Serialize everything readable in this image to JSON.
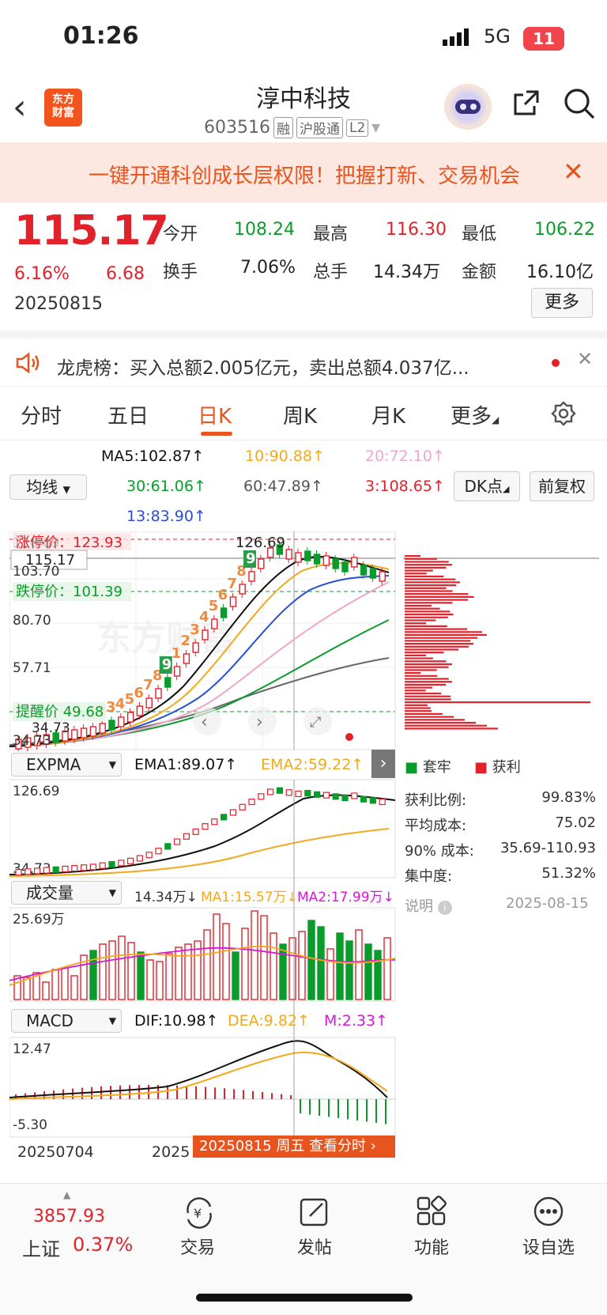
{
  "status": {
    "time": "01:26",
    "network": "5G",
    "battery": "11"
  },
  "header": {
    "app_logo": [
      "东方",
      "财富"
    ],
    "stock_name": "淳中科技",
    "stock_code": "603516",
    "tags": [
      "融",
      "沪股通",
      "L2"
    ]
  },
  "promo": {
    "text": "一键开通科创成长层权限！把握打新、交易机会"
  },
  "quote": {
    "price": "115.17",
    "change_pct": "6.16%",
    "change": "6.68",
    "date": "20250815",
    "open_label": "今开",
    "open": "108.24",
    "high_label": "最高",
    "high": "116.30",
    "low_label": "最低",
    "low": "106.22",
    "turnover_label": "换手",
    "turnover": "7.06%",
    "volume_label": "总手",
    "volume": "14.34万",
    "amount_label": "金额",
    "amount": "16.10亿",
    "more": "更多"
  },
  "lhb": {
    "text": "龙虎榜：买入总额2.005亿元，卖出总额4.037亿..."
  },
  "tabs": [
    "分时",
    "五日",
    "日K",
    "周K",
    "月K",
    "更多"
  ],
  "ma": {
    "ma5": "MA5:102.87↑",
    "ma10": "10:90.88↑",
    "ma20": "20:72.10↑",
    "ma30": "30:61.06↑",
    "ma60": "60:47.89↑",
    "ma3": "3:108.65↑",
    "ma13": "13:83.90↑",
    "select": "均线",
    "dk": "DK点",
    "fq": "前复权"
  },
  "kline": {
    "axis": [
      "126.69",
      "103.70",
      "80.70",
      "57.71",
      "34.73"
    ],
    "current_tag": "115.17",
    "zhangting": "涨停价：123.93",
    "dieting": "跌停价：101.39",
    "tixing": "提醒价 49.68",
    "high_mark": "126.69",
    "low_mark": "34.73",
    "seq_numbers": [
      "1",
      "2",
      "3",
      "4",
      "5",
      "6",
      "7",
      "8",
      "9",
      "1",
      "2",
      "3",
      "4",
      "5",
      "6",
      "7",
      "8",
      "9"
    ],
    "watermark": "东方财富"
  },
  "chip": {
    "legend_trap": "套牢",
    "legend_profit": "获利",
    "rows": [
      {
        "label": "获利比例:",
        "value": "99.83%"
      },
      {
        "label": "平均成本:",
        "value": "75.02"
      },
      {
        "label": "90% 成本:",
        "value": "35.69-110.93"
      },
      {
        "label": "集中度:",
        "value": "51.32%"
      }
    ],
    "note": "说明",
    "date": "2025-08-15"
  },
  "expma": {
    "select": "EXPMA",
    "ema1": "EMA1:89.07↑",
    "ema2": "EMA2:59.22↑",
    "top": "126.69",
    "bottom": "34.73"
  },
  "volume": {
    "select": "成交量",
    "vol": "14.34万↓",
    "ma1": "MA1:15.57万↓",
    "ma2": "MA2:17.99万↓",
    "top": "25.69万"
  },
  "macd": {
    "select": "MACD",
    "dif": "DIF:10.98↑",
    "dea": "DEA:9.82↑",
    "m": "M:2.33↑",
    "top": "12.47",
    "bottom": "-5.30"
  },
  "xaxis": {
    "left": "20250704",
    "mid": "2025",
    "right": "20250815"
  },
  "crosshair": {
    "text": "20250815 周五 查看分时"
  },
  "bottom": {
    "index_value": "3857.93",
    "index_name": "上证",
    "index_pct": "0.37%",
    "nav": [
      "交易",
      "发帖",
      "功能",
      "设自选"
    ]
  },
  "colors": {
    "up": "#e2222b",
    "down": "#0a9c2a",
    "accent": "#e8541e"
  }
}
